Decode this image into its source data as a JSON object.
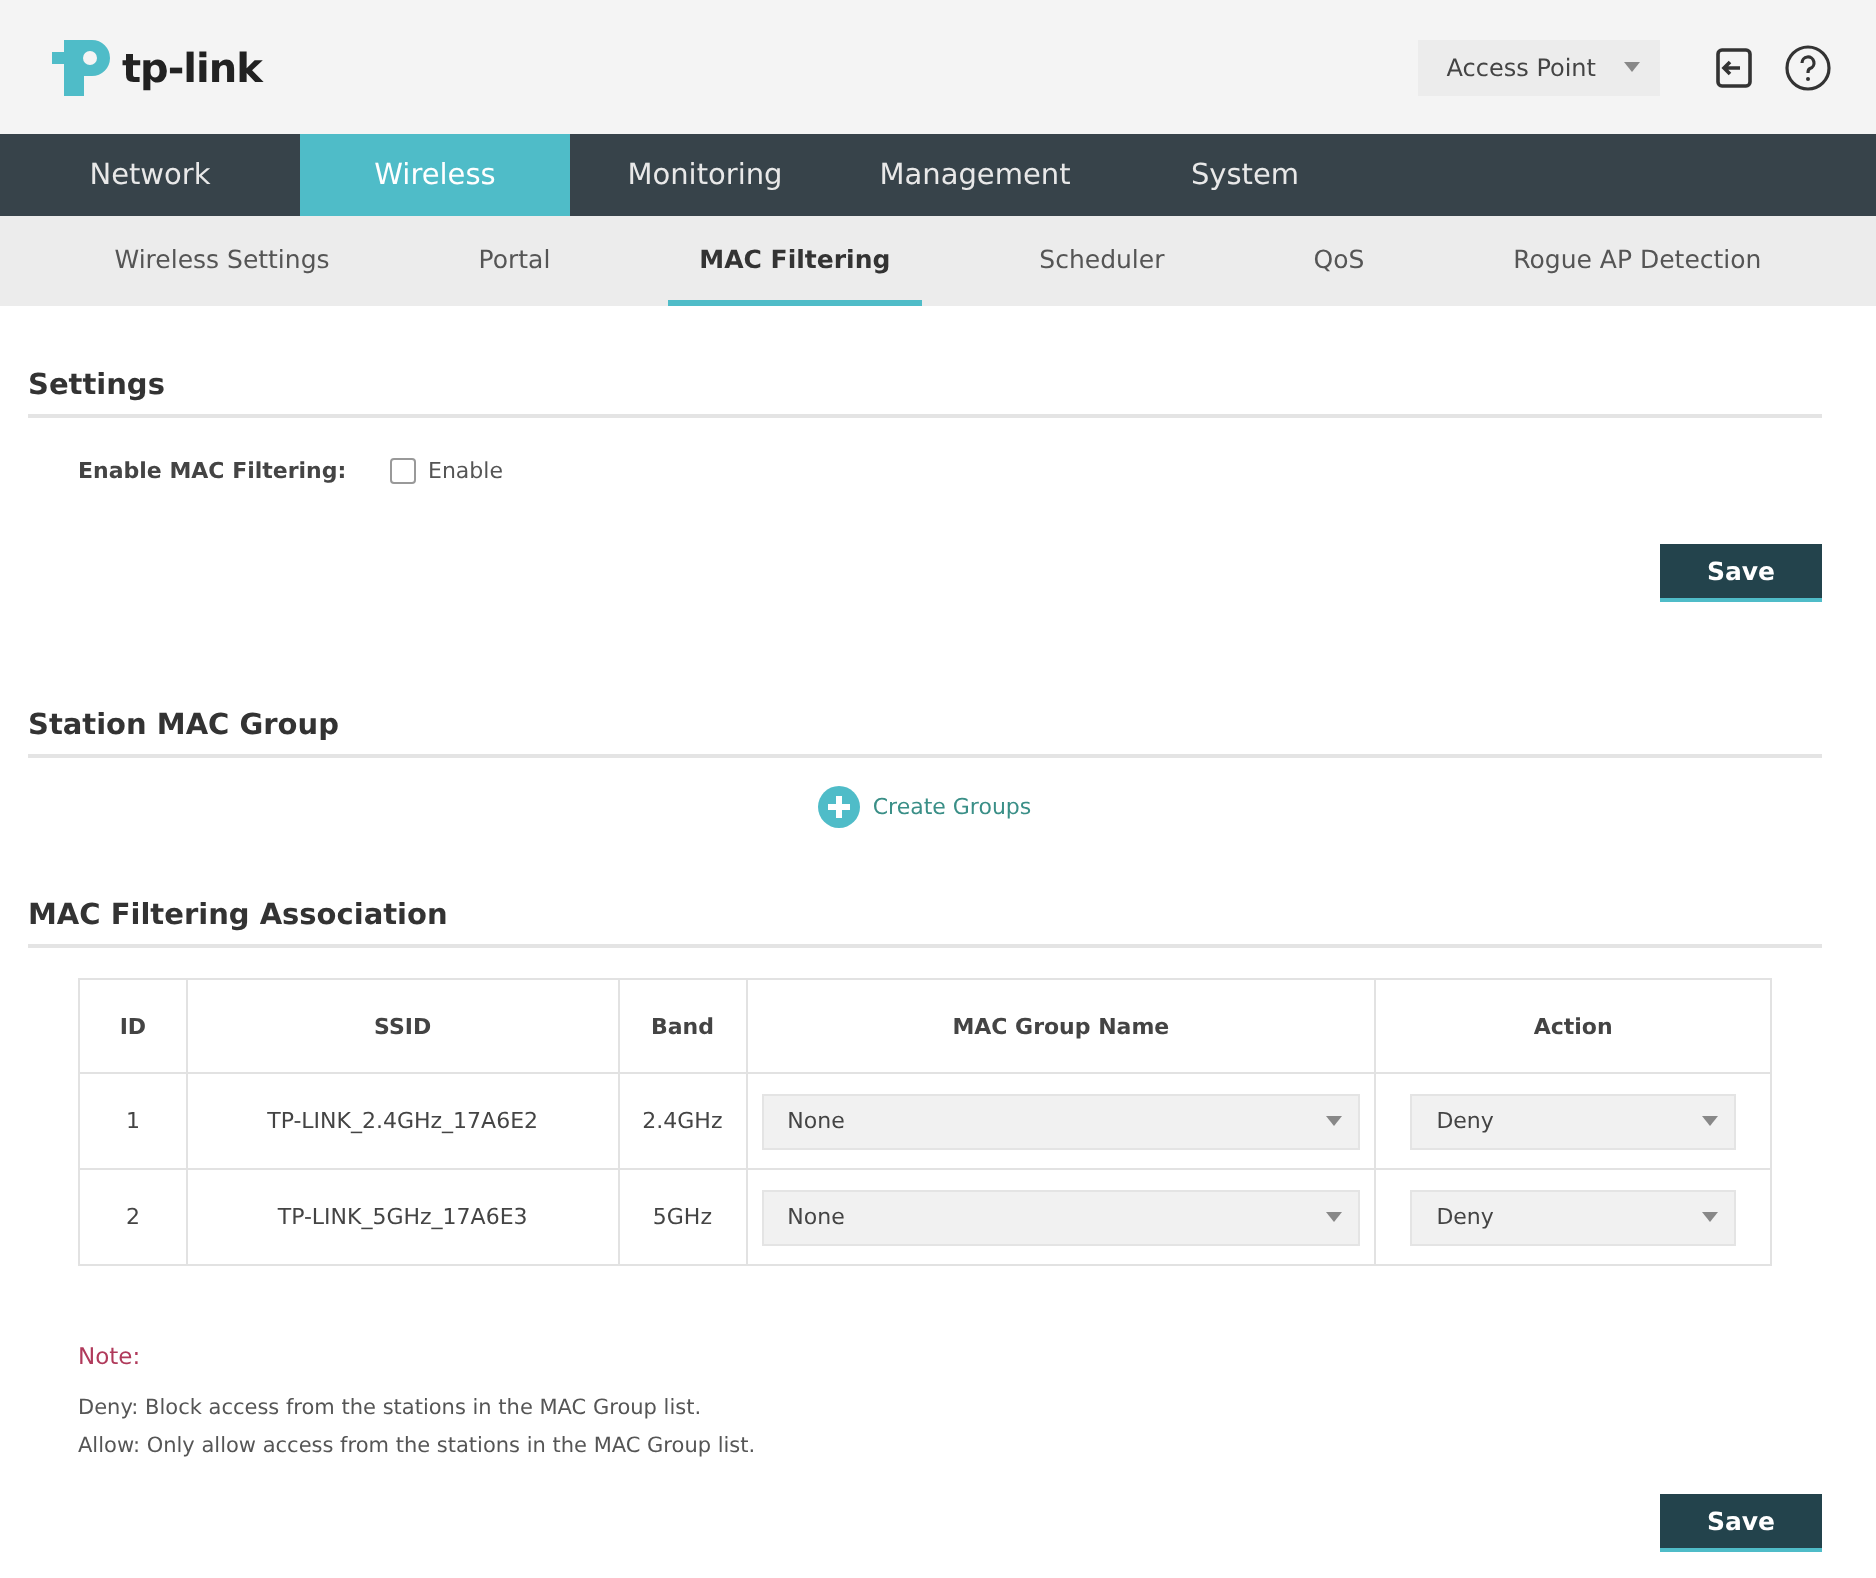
{
  "header": {
    "logo_text": "tp-link",
    "mode_select": {
      "value": "Access Point"
    }
  },
  "main_tabs": [
    {
      "label": "Network",
      "selected": false
    },
    {
      "label": "Wireless",
      "selected": true
    },
    {
      "label": "Monitoring",
      "selected": false
    },
    {
      "label": "Management",
      "selected": false
    },
    {
      "label": "System",
      "selected": false
    }
  ],
  "sub_tabs": [
    {
      "label": "Wireless Settings",
      "selected": false
    },
    {
      "label": "Portal",
      "selected": false
    },
    {
      "label": "MAC Filtering",
      "selected": true
    },
    {
      "label": "Scheduler",
      "selected": false
    },
    {
      "label": "QoS",
      "selected": false
    },
    {
      "label": "Rogue AP Detection",
      "selected": false
    }
  ],
  "settings": {
    "title": "Settings",
    "field_label": "Enable MAC Filtering:",
    "checkbox": {
      "label": "Enable",
      "checked": false
    },
    "save_button": "Save"
  },
  "station_mac_group": {
    "title": "Station MAC Group",
    "create_link": "Create Groups"
  },
  "association": {
    "title": "MAC Filtering Association",
    "table": {
      "columns": [
        "ID",
        "SSID",
        "Band",
        "MAC Group Name",
        "Action"
      ],
      "rows": [
        {
          "id": "1",
          "ssid": "TP-LINK_2.4GHz_17A6E2",
          "band": "2.4GHz",
          "mac_group": "None",
          "action": "Deny"
        },
        {
          "id": "2",
          "ssid": "TP-LINK_5GHz_17A6E3",
          "band": "5GHz",
          "mac_group": "None",
          "action": "Deny"
        }
      ]
    },
    "note_title": "Note:",
    "notes": [
      "Deny: Block access from the stations in the MAC Group list.",
      "Allow: Only allow access from the stations in the MAC Group list."
    ],
    "save_button": "Save"
  }
}
